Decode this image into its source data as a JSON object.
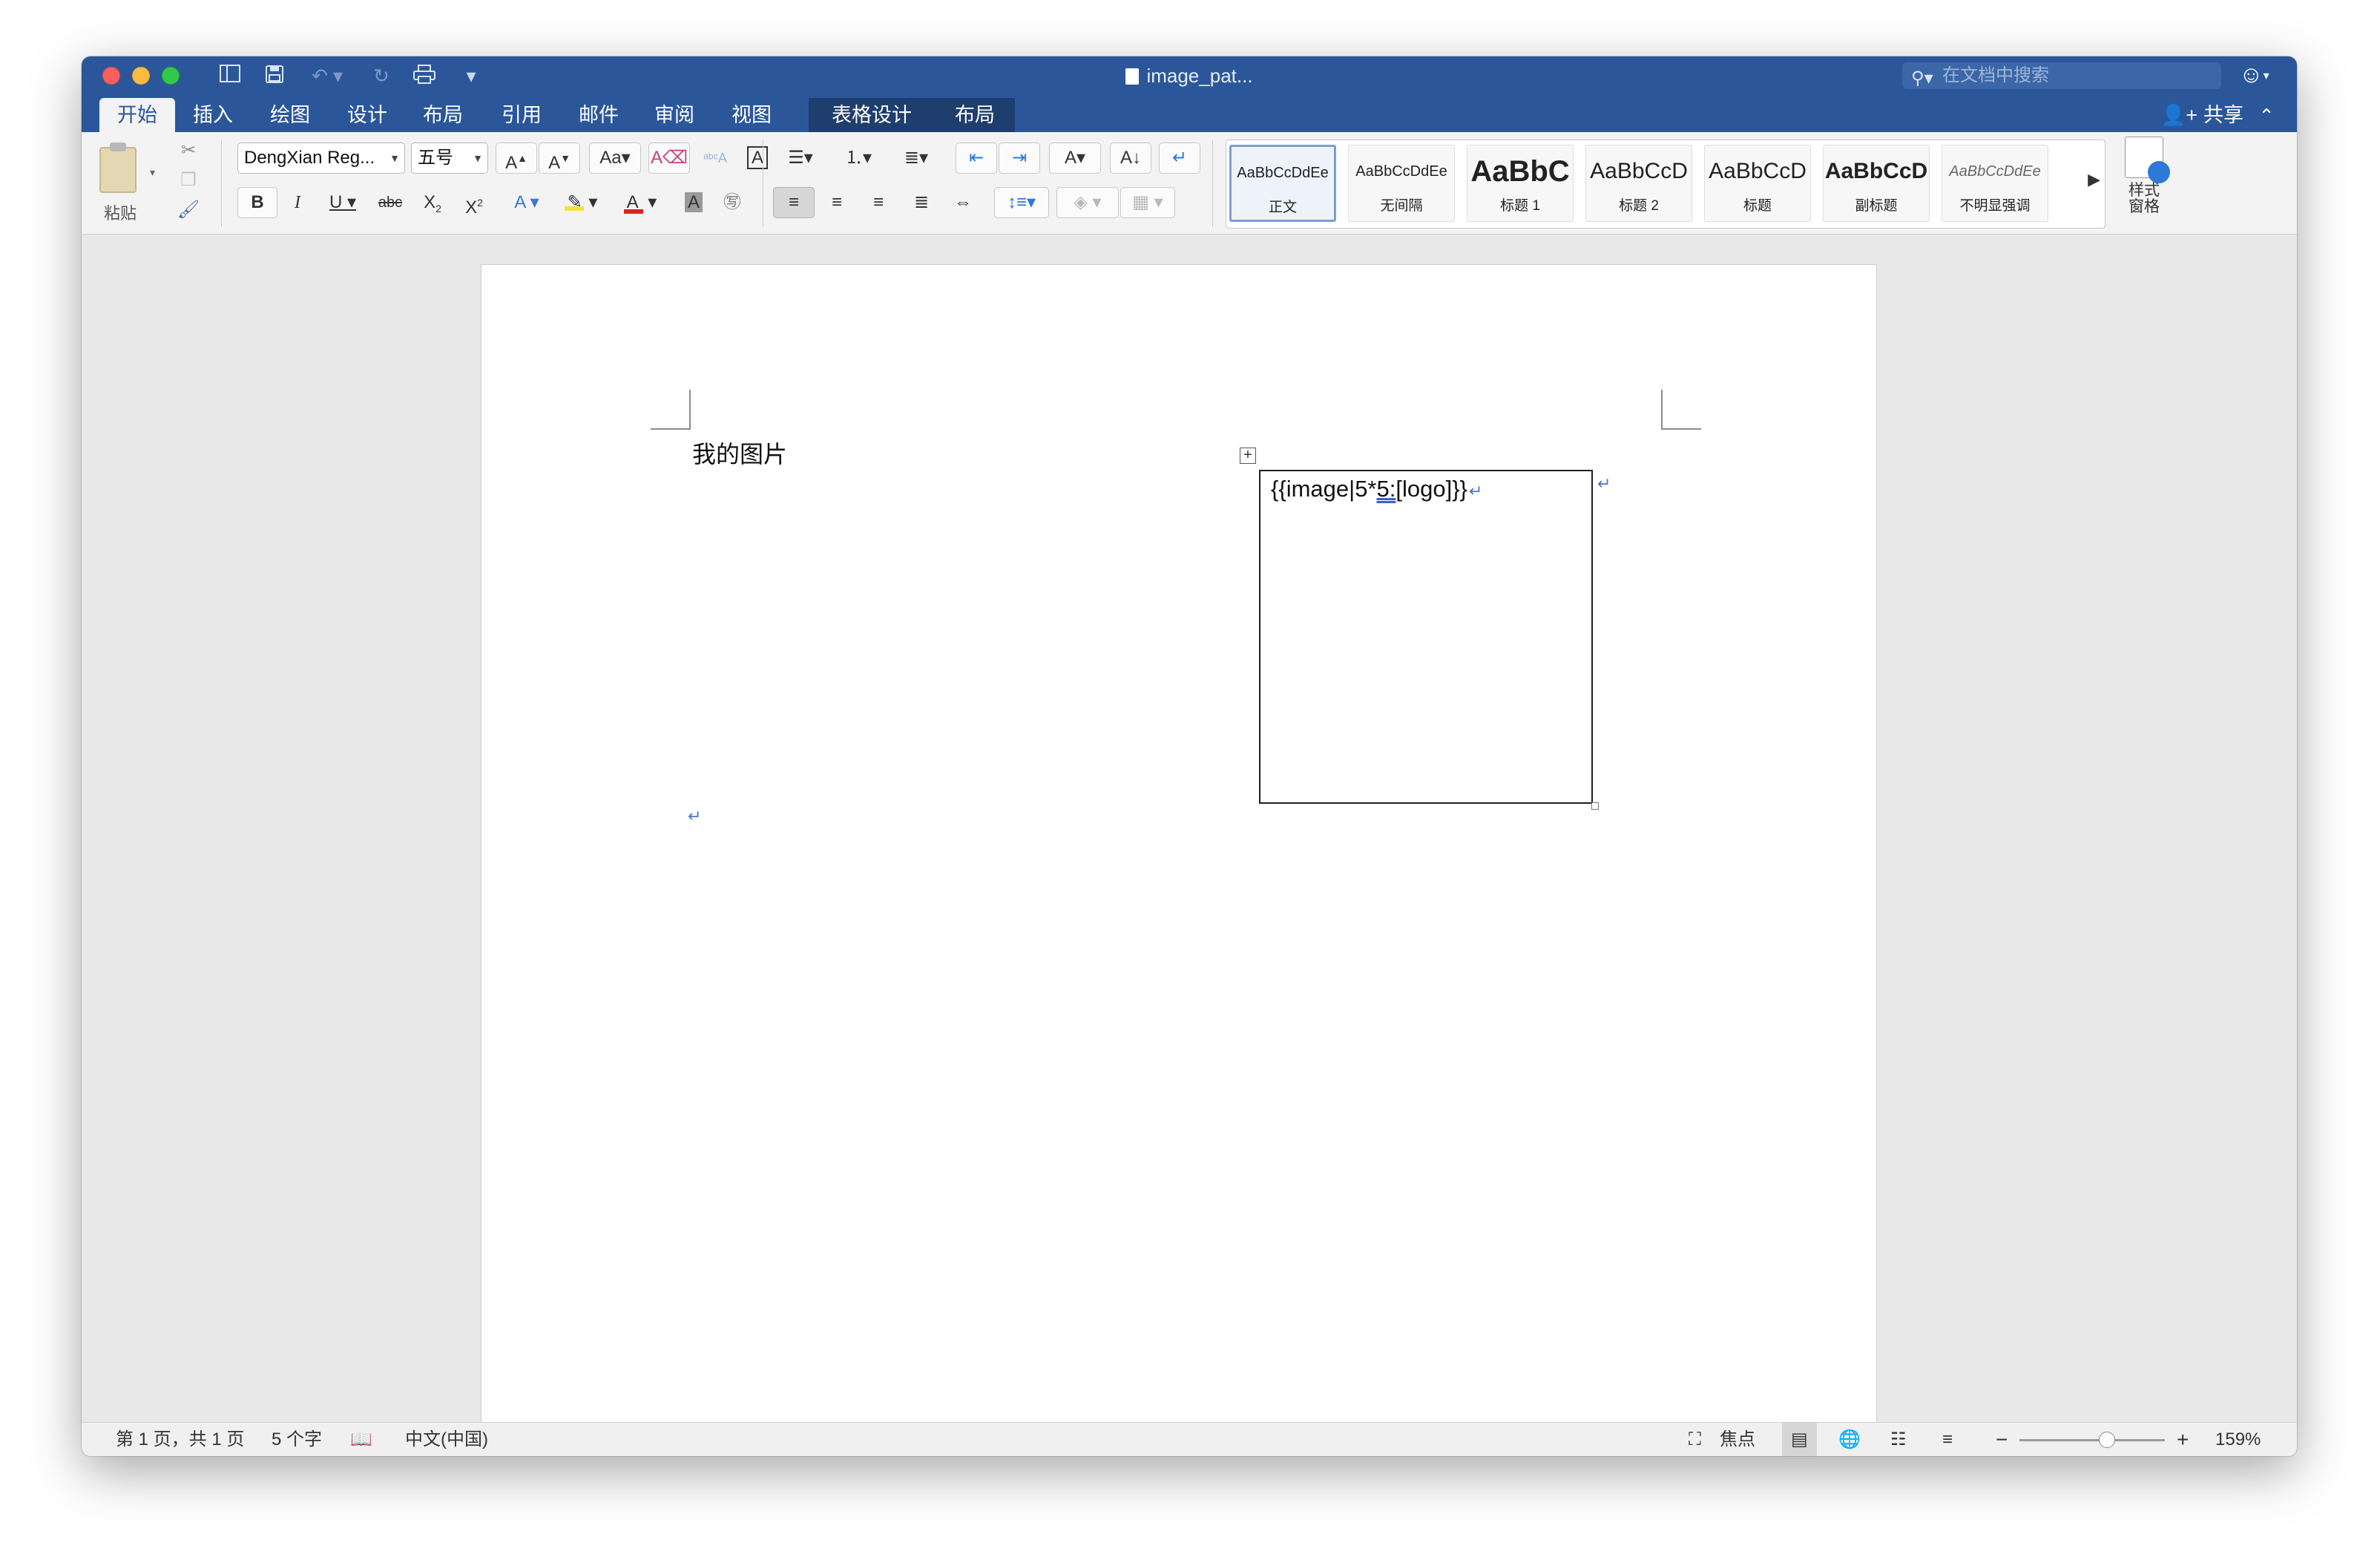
{
  "window": {
    "title": "image_pat..."
  },
  "search": {
    "placeholder": "在文档中搜索"
  },
  "tabs": [
    {
      "label": "开始",
      "active": true
    },
    {
      "label": "插入"
    },
    {
      "label": "绘图"
    },
    {
      "label": "设计"
    },
    {
      "label": "布局"
    },
    {
      "label": "引用"
    },
    {
      "label": "邮件"
    },
    {
      "label": "审阅"
    },
    {
      "label": "视图"
    },
    {
      "label": "表格设计",
      "contextual": true
    },
    {
      "label": "布局",
      "contextual": true
    }
  ],
  "share": {
    "label": "共享"
  },
  "ribbon": {
    "paste_label": "粘贴",
    "font_name": "DengXian Reg...",
    "font_size": "五号",
    "styles": [
      {
        "sample": "AaBbCcDdEe",
        "name": "正文",
        "selected": true
      },
      {
        "sample": "AaBbCcDdEe",
        "name": "无间隔"
      },
      {
        "sample": "AaBbC",
        "name": "标题 1"
      },
      {
        "sample": "AaBbCcD",
        "name": "标题 2"
      },
      {
        "sample": "AaBbCcD",
        "name": "标题"
      },
      {
        "sample": "AaBbCcD",
        "name": "副标题"
      },
      {
        "sample": "AaBbCcDdEe",
        "name": "不明显强调"
      }
    ],
    "styles_pane_label": "样式窗格"
  },
  "document": {
    "heading": "我的图片",
    "cell_text_before": "{{image|5*",
    "cell_text_underlined": "5:",
    "cell_text_after": "[logo]}}",
    "para_mark": "↵"
  },
  "status": {
    "page": "第 1 页，共 1 页",
    "words": "5 个字",
    "language": "中文(中国)",
    "focus": "焦点",
    "zoom": "159%",
    "zoom_level_percent": 60
  },
  "colors": {
    "accent": "#2b579a",
    "font_color_underline": "#e02020"
  }
}
